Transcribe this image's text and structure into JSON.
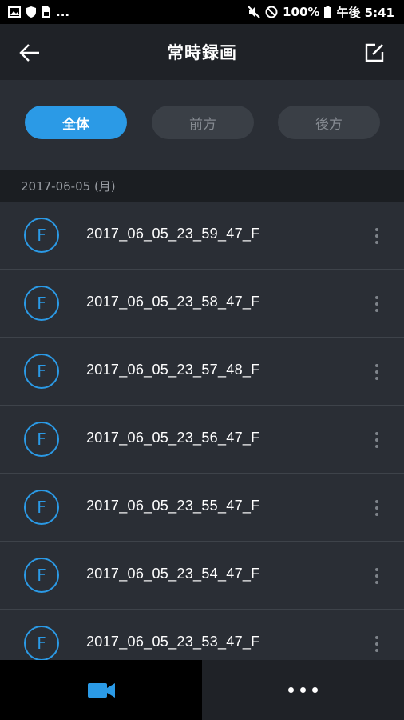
{
  "status_bar": {
    "left_icons": [
      "image-icon",
      "shield-icon",
      "sim-icon"
    ],
    "ellipsis": "...",
    "right_icons": [
      "mute-icon",
      "do-not-disturb-icon"
    ],
    "battery": "100%",
    "time": "午後 5:41"
  },
  "app_bar": {
    "title": "常時録画",
    "back_icon": "back-arrow-icon",
    "edit_icon": "edit-icon"
  },
  "filters": [
    {
      "label": "全体",
      "active": true
    },
    {
      "label": "前方",
      "active": false
    },
    {
      "label": "後方",
      "active": false
    }
  ],
  "date_header": "2017-06-05 (月)",
  "recordings": [
    {
      "badge": "F",
      "name": "2017_06_05_23_59_47_F"
    },
    {
      "badge": "F",
      "name": "2017_06_05_23_58_47_F"
    },
    {
      "badge": "F",
      "name": "2017_06_05_23_57_48_F"
    },
    {
      "badge": "F",
      "name": "2017_06_05_23_56_47_F"
    },
    {
      "badge": "F",
      "name": "2017_06_05_23_55_47_F"
    },
    {
      "badge": "F",
      "name": "2017_06_05_23_54_47_F"
    },
    {
      "badge": "F",
      "name": "2017_06_05_23_53_47_F"
    }
  ],
  "bottom_nav": {
    "left_icon": "video-camera-icon",
    "right_icon": "more-horizontal-icon"
  },
  "colors": {
    "accent": "#2b9ae6",
    "background": "#1f2227",
    "list_background": "#2a2e35"
  }
}
